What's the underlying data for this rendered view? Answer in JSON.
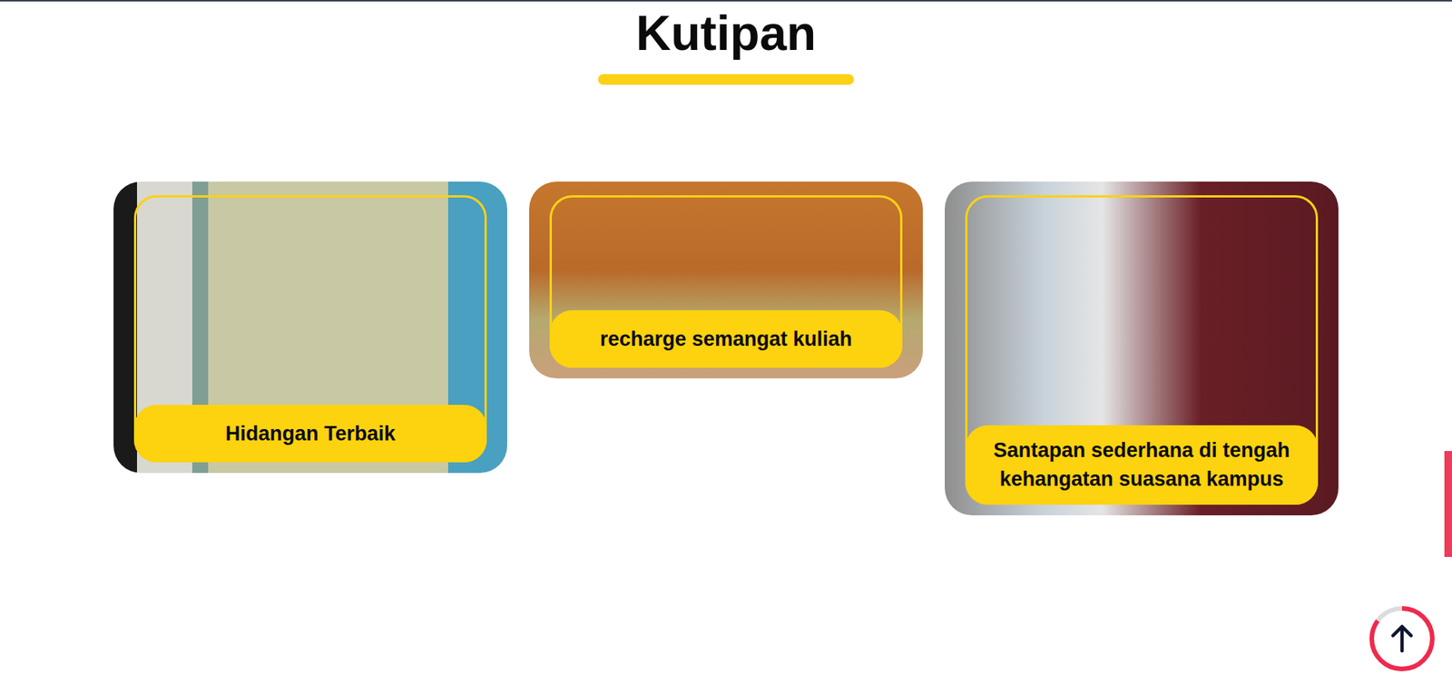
{
  "section": {
    "title": "Kutipan"
  },
  "cards": [
    {
      "caption": "Hidangan Terbaik"
    },
    {
      "caption": "recharge semangat kuliah"
    },
    {
      "caption": "Santapan sederhana di tengah kehangatan suasana kampus"
    }
  ],
  "scrollTop": {
    "level": 0.85
  }
}
